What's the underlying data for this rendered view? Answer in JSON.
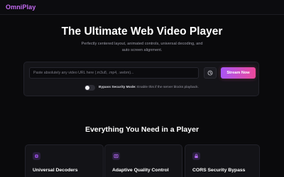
{
  "app": {
    "logo": "OmniPlay"
  },
  "hero": {
    "title": "The Ultimate Web Video Player",
    "subtitle_line1": "Perfectly centered layout, animated controls, universal decoding, and",
    "subtitle_line2": "auto screen alignment."
  },
  "player_form": {
    "url_placeholder": "Paste absolutely any video URL here (.m3u8, .mp4, .webm)...",
    "url_value": "",
    "history_icon": "history-icon",
    "stream_label": "Stream Now",
    "bypass_toggle_on": false,
    "bypass_label": "Bypass Security Mode:",
    "bypass_description": "Enable this if the server blocks playback."
  },
  "features": {
    "title": "Everything You Need in a Player",
    "cards": [
      {
        "icon": "chip-icon",
        "title": "Universal Decoders"
      },
      {
        "icon": "quality-icon",
        "title": "Adaptive Quality Control"
      },
      {
        "icon": "lock-icon",
        "title": "CORS Security Bypass"
      }
    ]
  },
  "colors": {
    "accent_start": "#a855f7",
    "accent_end": "#ec4899",
    "logo": "#c56bf2",
    "background": "#0a0a0c"
  }
}
